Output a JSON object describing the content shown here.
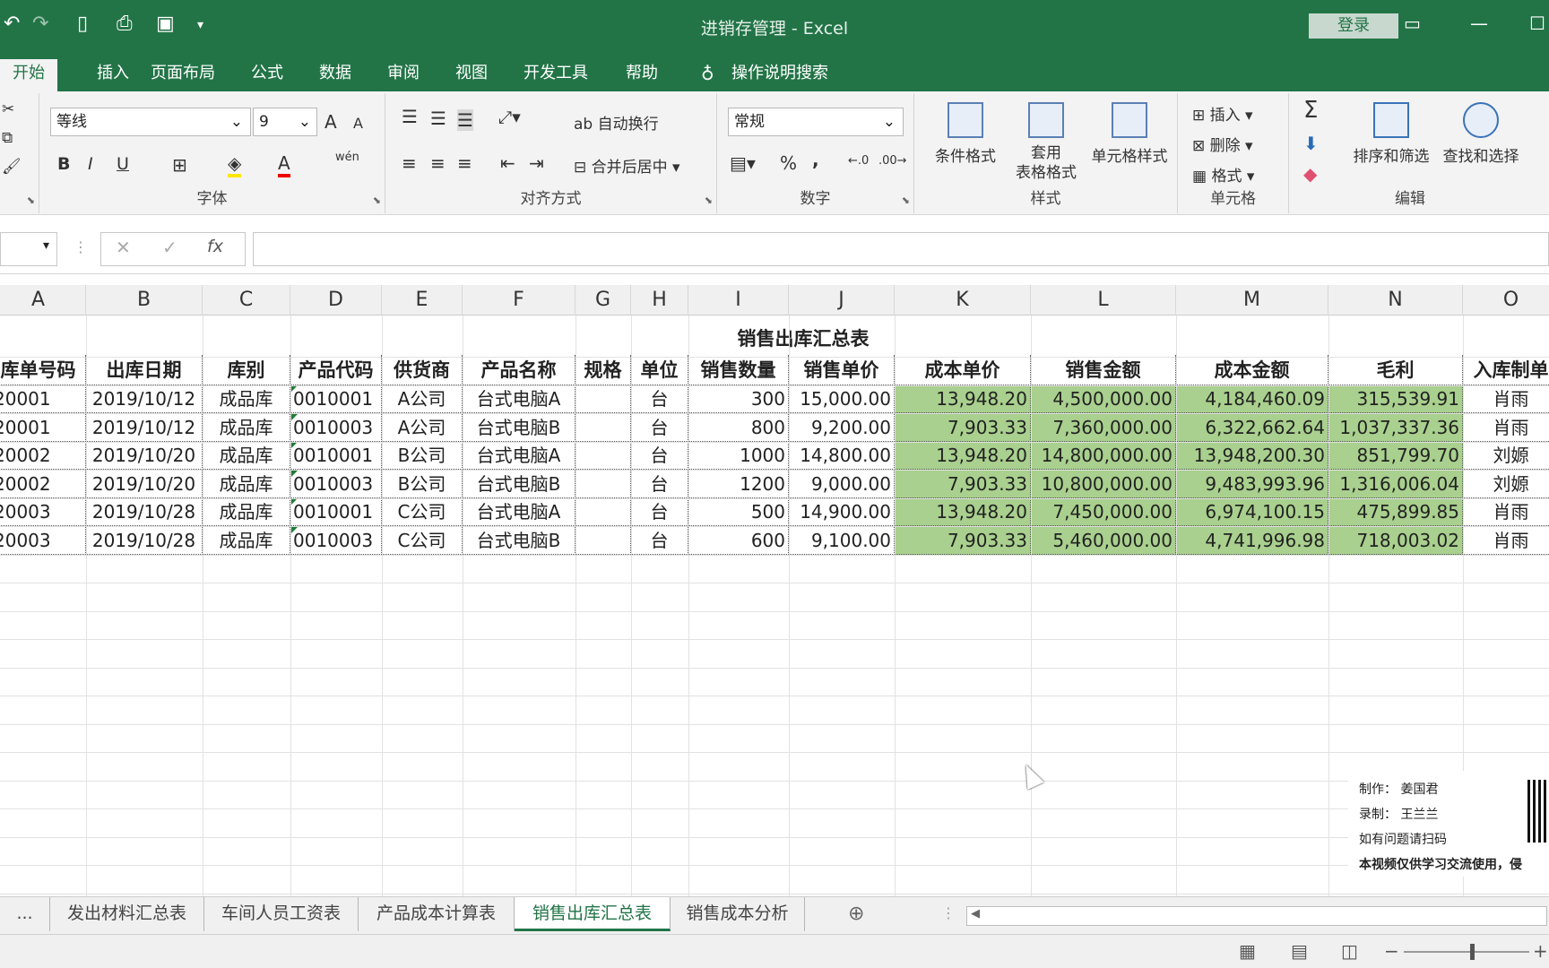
{
  "window": {
    "title": "进销存管理  -  Excel",
    "login": "登录"
  },
  "tabs": [
    "开始",
    "插入",
    "页面布局",
    "公式",
    "数据",
    "审阅",
    "视图",
    "开发工具",
    "帮助",
    "操作说明搜索"
  ],
  "ribbon": {
    "font": {
      "name": "等线",
      "size": "9",
      "label": "字体",
      "bold": "B",
      "italic": "I",
      "underline": "U",
      "grow": "A",
      "shrink": "A",
      "wen": "wén"
    },
    "align": {
      "label": "对齐方式",
      "wrap": "自动换行",
      "merge": "合并后居中"
    },
    "number": {
      "label": "数字",
      "format": "常规",
      "percent": "%",
      "comma": ","
    },
    "styles": {
      "label": "样式",
      "cond": "条件格式",
      "table1": "套用",
      "table2": "表格格式",
      "cell": "单元格样式"
    },
    "cells": {
      "label": "单元格",
      "insert": "插入",
      "delete": "删除",
      "format": "格式"
    },
    "edit": {
      "label": "编辑",
      "sort": "排序和筛选",
      "find": "查找和选择",
      "sum": "Σ"
    }
  },
  "formula_bar": {
    "cancel": "✕",
    "confirm": "✓",
    "fx": "fx"
  },
  "columns": [
    "A",
    "B",
    "C",
    "D",
    "E",
    "F",
    "G",
    "H",
    "I",
    "J",
    "K",
    "L",
    "M",
    "N",
    "O"
  ],
  "sheet": {
    "title": "销售出库汇总表",
    "headers": [
      "库单号码",
      "出库日期",
      "库别",
      "产品代码",
      "供货商",
      "产品名称",
      "规格",
      "单位",
      "销售数量",
      "销售单价",
      "成本单价",
      "销售金额",
      "成本金额",
      "毛利",
      "入库制单"
    ],
    "rows": [
      [
        "20001",
        "2019/10/12",
        "成品库",
        "0010001",
        "A公司",
        "台式电脑A",
        "",
        "台",
        "300",
        "15,000.00",
        "13,948.20",
        "4,500,000.00",
        "4,184,460.09",
        "315,539.91",
        "肖雨"
      ],
      [
        "20001",
        "2019/10/12",
        "成品库",
        "0010003",
        "A公司",
        "台式电脑B",
        "",
        "台",
        "800",
        "9,200.00",
        "7,903.33",
        "7,360,000.00",
        "6,322,662.64",
        "1,037,337.36",
        "肖雨"
      ],
      [
        "20002",
        "2019/10/20",
        "成品库",
        "0010001",
        "B公司",
        "台式电脑A",
        "",
        "台",
        "1000",
        "14,800.00",
        "13,948.20",
        "14,800,000.00",
        "13,948,200.30",
        "851,799.70",
        "刘嫄"
      ],
      [
        "20002",
        "2019/10/20",
        "成品库",
        "0010003",
        "B公司",
        "台式电脑B",
        "",
        "台",
        "1200",
        "9,000.00",
        "7,903.33",
        "10,800,000.00",
        "9,483,993.96",
        "1,316,006.04",
        "刘嫄"
      ],
      [
        "20003",
        "2019/10/28",
        "成品库",
        "0010001",
        "C公司",
        "台式电脑A",
        "",
        "台",
        "500",
        "14,900.00",
        "13,948.20",
        "7,450,000.00",
        "6,974,100.15",
        "475,899.85",
        "肖雨"
      ],
      [
        "20003",
        "2019/10/28",
        "成品库",
        "0010003",
        "C公司",
        "台式电脑B",
        "",
        "台",
        "600",
        "9,100.00",
        "7,903.33",
        "5,460,000.00",
        "4,741,996.98",
        "718,003.02",
        "肖雨"
      ]
    ]
  },
  "watermark": {
    "line1": "制作：      姜国君",
    "line2": "录制：      王兰兰",
    "line3": "如有问题请扫码",
    "line4": "本视频仅供学习交流使用，侵"
  },
  "sheet_tabs": [
    "...",
    "发出材料汇总表",
    "车间人员工资表",
    "产品成本计算表",
    "销售出库汇总表",
    "销售成本分析"
  ],
  "colors": {
    "excel_green": "#227447",
    "cell_highlight": "#a9d08e"
  }
}
